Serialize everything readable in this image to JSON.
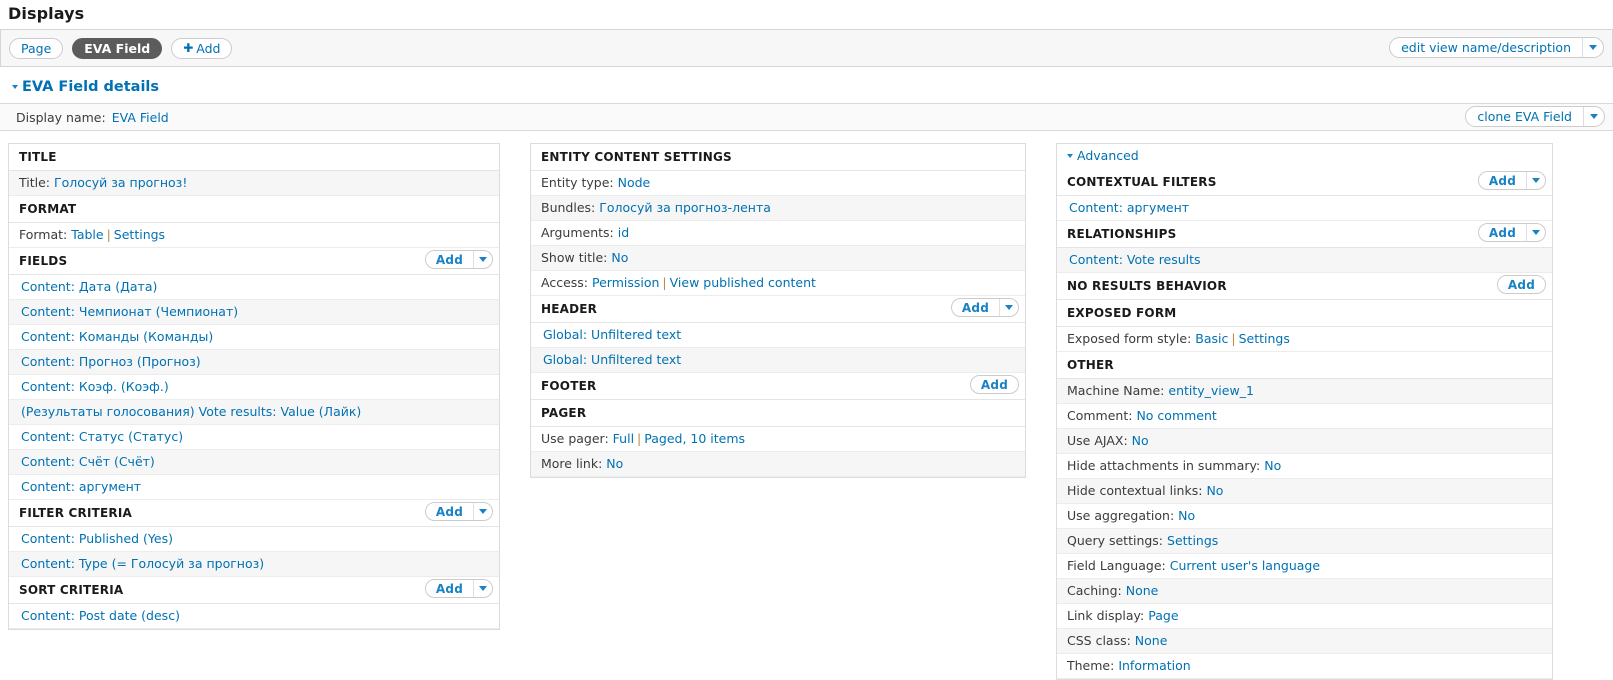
{
  "page": {
    "title": "Displays"
  },
  "tabs": {
    "items": [
      {
        "label": "Page",
        "active": false
      },
      {
        "label": "EVA Field",
        "active": true
      }
    ],
    "add_label": "Add",
    "edit_view_label": "edit view name/description"
  },
  "details": {
    "heading": "EVA Field details",
    "display_name_label": "Display name:",
    "display_name_value": "EVA Field",
    "clone_label": "clone EVA Field"
  },
  "buttons": {
    "add": "Add"
  },
  "left": {
    "title_group": {
      "heading": "TITLE",
      "rows": [
        {
          "label": "Title:",
          "value": "Голосуй за прогноз!"
        }
      ]
    },
    "format_group": {
      "heading": "FORMAT",
      "rows": [
        {
          "label": "Format:",
          "value": "Table",
          "value2": "Settings"
        }
      ]
    },
    "fields_group": {
      "heading": "FIELDS",
      "items": [
        "Content: Дата (Дата)",
        "Content: Чемпионат (Чемпионат)",
        "Content: Команды (Команды)",
        "Content: Прогноз (Прогноз)",
        "Content: Коэф. (Коэф.)",
        "(Результаты голосования) Vote results: Value (Лайк)",
        "Content: Статус (Статус)",
        "Content: Счёт (Счёт)",
        "Content: аргумент"
      ]
    },
    "filter_group": {
      "heading": "FILTER CRITERIA",
      "items": [
        "Content: Published (Yes)",
        "Content: Type (= Голосуй за прогноз)"
      ]
    },
    "sort_group": {
      "heading": "SORT CRITERIA",
      "items": [
        "Content: Post date (desc)"
      ]
    }
  },
  "mid": {
    "entity_group": {
      "heading": "ENTITY CONTENT SETTINGS",
      "rows": [
        {
          "label": "Entity type:",
          "value": "Node"
        },
        {
          "label": "Bundles:",
          "value": "Голосуй за прогноз-лента"
        },
        {
          "label": "Arguments:",
          "value": "id"
        },
        {
          "label": "Show title:",
          "value": "No"
        },
        {
          "label": "Access:",
          "value": "Permission",
          "value2": "View published content"
        }
      ]
    },
    "header_group": {
      "heading": "HEADER",
      "items": [
        "Global: Unfiltered text",
        "Global: Unfiltered text"
      ]
    },
    "footer_group": {
      "heading": "FOOTER",
      "items": []
    },
    "pager_group": {
      "heading": "PAGER",
      "rows": [
        {
          "label": "Use pager:",
          "value": "Full",
          "value2": "Paged, 10 items"
        },
        {
          "label": "More link:",
          "value": "No"
        }
      ]
    }
  },
  "right": {
    "advanced_label": "Advanced",
    "contextual_group": {
      "heading": "CONTEXTUAL FILTERS",
      "items": [
        "Content: аргумент"
      ]
    },
    "relationships_group": {
      "heading": "RELATIONSHIPS",
      "items": [
        "Content: Vote results"
      ]
    },
    "no_results_group": {
      "heading": "NO RESULTS BEHAVIOR",
      "items": []
    },
    "exposed_form_group": {
      "heading": "EXPOSED FORM",
      "rows": [
        {
          "label": "Exposed form style:",
          "value": "Basic",
          "value2": "Settings"
        }
      ]
    },
    "other_group": {
      "heading": "OTHER",
      "rows": [
        {
          "label": "Machine Name:",
          "value": "entity_view_1"
        },
        {
          "label": "Comment:",
          "value": "No comment"
        },
        {
          "label": "Use AJAX:",
          "value": "No"
        },
        {
          "label": "Hide attachments in summary:",
          "value": "No"
        },
        {
          "label": "Hide contextual links:",
          "value": "No"
        },
        {
          "label": "Use aggregation:",
          "value": "No"
        },
        {
          "label": "Query settings:",
          "value": "Settings"
        },
        {
          "label": "Field Language:",
          "value": "Current user's language"
        },
        {
          "label": "Caching:",
          "value": "None"
        },
        {
          "label": "Link display:",
          "value": "Page"
        },
        {
          "label": "CSS class:",
          "value": "None"
        },
        {
          "label": "Theme:",
          "value": "Information"
        }
      ]
    }
  },
  "colors": {
    "link": "#0071b3",
    "active_tab_bg": "#5c5c5c",
    "separator": "#c08a3e"
  }
}
